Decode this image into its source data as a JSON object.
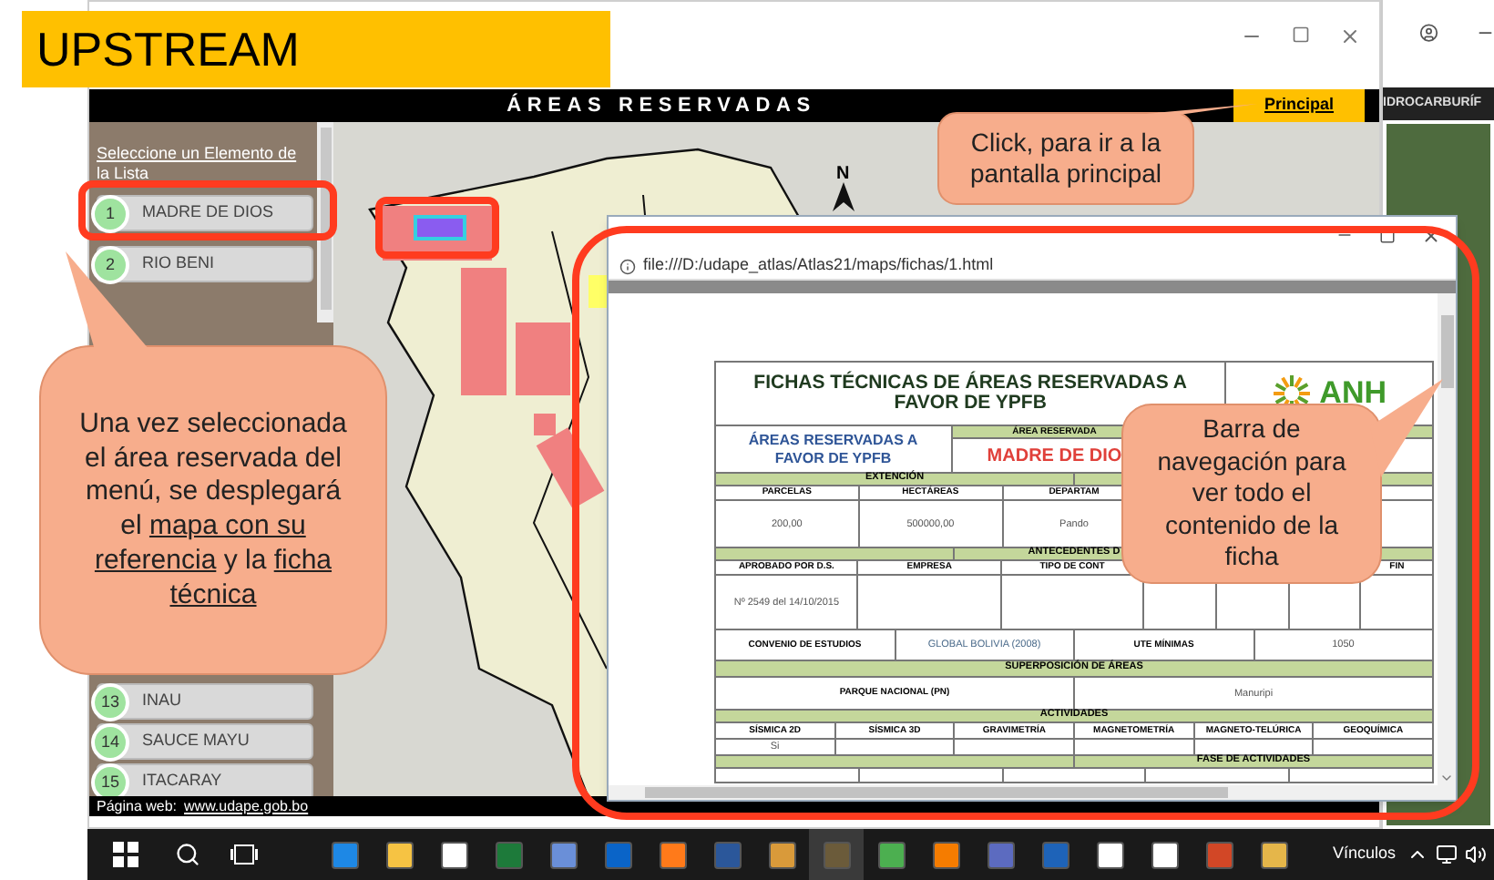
{
  "banner": {
    "title": "UPSTREAM"
  },
  "main_window": {
    "header_title": "ÁREAS RESERVADAS",
    "principal_link": "Principal",
    "sidebar": {
      "heading": "Seleccione un Elemento de la Lista",
      "upper_items": [
        {
          "number": "1",
          "label": "MADRE DE DIOS"
        },
        {
          "number": "2",
          "label": "RIO BENI"
        }
      ],
      "lower_items": [
        {
          "number": "13",
          "label": "INAU"
        },
        {
          "number": "14",
          "label": "SAUCE MAYU"
        },
        {
          "number": "15",
          "label": "ITACARAY"
        }
      ]
    },
    "map": {
      "compass_label": "N"
    },
    "footer": {
      "label": "Página web:",
      "link": "www.udape.gob.bo"
    }
  },
  "side_window": {
    "header_title": "IDROCARBURÍF"
  },
  "popup": {
    "address": "file:///D:/udape_atlas/Atlas21/maps/fichas/1.html",
    "sheet": {
      "lines": [
        {
          "kind": "title",
          "fields": [
            {
              "kind": "title",
              "text": "FICHAS TÉCNICAS DE ÁREAS RESERVADAS A FAVOR DE YPFB"
            },
            {
              "kind": "logo",
              "text": "ANH"
            }
          ]
        },
        {
          "kind": "band",
          "fields": [
            {
              "kind": "subtitle",
              "text": "ÁREAS RESERVADAS A FAVOR DE YPFB"
            },
            {
              "kind": "area",
              "label": "ÁREA RESERVADA",
              "text": "MADRE DE DIO"
            },
            {
              "kind": "area"
            }
          ]
        },
        {
          "kind": "section",
          "fields": [
            {
              "kind": "section",
              "text": "EXTENCIÓN"
            },
            {
              "kind": "section"
            }
          ]
        },
        {
          "kind": "header",
          "fields": [
            {
              "kind": "header",
              "text": "PARCELAS"
            },
            {
              "kind": "header",
              "text": "HECTÁREAS"
            },
            {
              "kind": "header",
              "text": "DEPARTAM"
            },
            {
              "kind": "header"
            },
            {
              "kind": "header"
            }
          ]
        },
        {
          "kind": "value",
          "fields": [
            {
              "kind": "value",
              "text": "200,00"
            },
            {
              "kind": "value",
              "text": "500000,00"
            },
            {
              "kind": "value",
              "text": "Pando"
            },
            {
              "kind": "value"
            },
            {
              "kind": "value"
            }
          ]
        },
        {
          "kind": "section",
          "fields": [
            {
              "kind": "section"
            },
            {
              "kind": "section",
              "text": "ANTECEDENTES D"
            },
            {
              "kind": "section"
            }
          ]
        },
        {
          "kind": "header",
          "fields": [
            {
              "kind": "header",
              "text": "APROBADO POR D.S."
            },
            {
              "kind": "header",
              "text": "EMPRESA"
            },
            {
              "kind": "header",
              "text": "TIPO DE CONT"
            },
            {
              "kind": "narrow"
            },
            {
              "kind": "narrow"
            },
            {
              "kind": "narrow"
            },
            {
              "kind": "narrow",
              "text": "FIN"
            }
          ]
        },
        {
          "kind": "tall",
          "fields": [
            {
              "kind": "value",
              "text": "Nº 2549 del 14/10/2015"
            },
            {
              "kind": "value"
            },
            {
              "kind": "value"
            },
            {
              "kind": "narrow"
            },
            {
              "kind": "narrow"
            },
            {
              "kind": "narrow"
            },
            {
              "kind": "narrow"
            }
          ]
        },
        {
          "kind": "line",
          "fields": [
            {
              "kind": "header",
              "text": "CONVENIO DE ESTUDIOS"
            },
            {
              "kind": "value_blue",
              "text": "GLOBAL BOLIVIA (2008)"
            },
            {
              "kind": "header",
              "text": "UTE MÍNIMAS"
            },
            {
              "kind": "value",
              "text": "1050"
            }
          ]
        },
        {
          "kind": "short",
          "fields": [
            {
              "kind": "section",
              "text": "SUPERPOSICIÓN DE ÁREAS"
            }
          ]
        },
        {
          "kind": "mid",
          "fields": [
            {
              "kind": "header",
              "text": "PARQUE NACIONAL (PN)"
            },
            {
              "kind": "value",
              "text": "Manuripi"
            }
          ]
        },
        {
          "kind": "section",
          "fields": [
            {
              "kind": "section",
              "text": "ACTIVIDADES"
            }
          ]
        },
        {
          "kind": "short",
          "fields": [
            {
              "kind": "header",
              "text": "SÍSMICA 2D"
            },
            {
              "kind": "header",
              "text": "SÍSMICA 3D"
            },
            {
              "kind": "header",
              "text": "GRAVIMETRÍA"
            },
            {
              "kind": "header",
              "text": "MAGNETOMETRÍA"
            },
            {
              "kind": "header",
              "text": "MAGNETO-TELÚRICA"
            },
            {
              "kind": "header",
              "text": "GEOQUÍMICA"
            }
          ]
        },
        {
          "kind": "short",
          "fields": [
            {
              "kind": "value",
              "text": "Si"
            },
            {
              "kind": "value"
            },
            {
              "kind": "value"
            },
            {
              "kind": "value"
            },
            {
              "kind": "value"
            },
            {
              "kind": "value"
            }
          ]
        },
        {
          "kind": "section",
          "fields": [
            {
              "kind": "section"
            },
            {
              "kind": "section",
              "text": "FASE DE ACTIVIDADES"
            }
          ]
        },
        {
          "kind": "header",
          "fields": [
            {
              "kind": "header"
            },
            {
              "kind": "header"
            },
            {
              "kind": "header"
            },
            {
              "kind": "header"
            },
            {
              "kind": "header"
            }
          ]
        }
      ]
    }
  },
  "callouts": [
    {
      "kind": "left",
      "parts": [
        {
          "text": "Una vez seleccionada el área reservada del menú, se desplegará el ",
          "underlined": false
        },
        {
          "text": "mapa con su referencia",
          "underlined": true
        },
        {
          "text": " y la ",
          "underlined": false
        },
        {
          "text": "ficha técnica",
          "underlined": true
        }
      ]
    },
    {
      "kind": "top",
      "parts": [
        {
          "text": "Click, para ir a la pantalla principal",
          "underlined": false
        }
      ]
    },
    {
      "kind": "right",
      "parts": [
        {
          "text": "Barra de navegación para ver todo el contenido de la ficha",
          "underlined": false
        }
      ]
    }
  ],
  "taskbar": {
    "tray_label": "Vínculos"
  }
}
